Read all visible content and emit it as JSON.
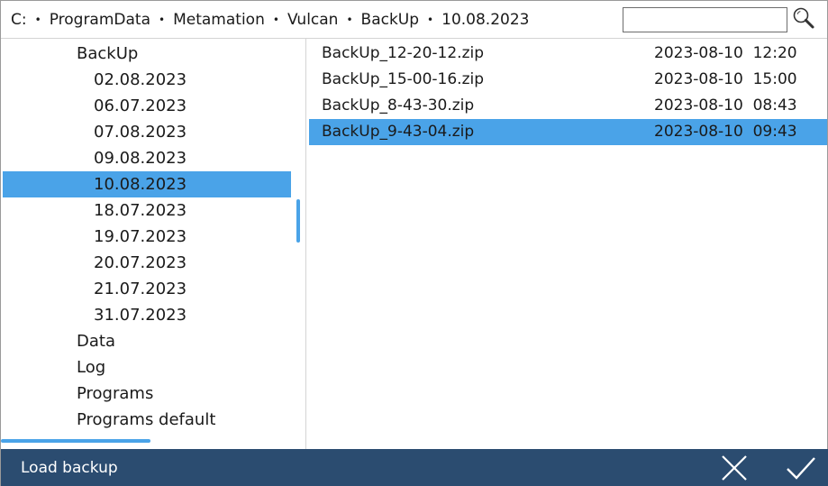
{
  "breadcrumb": {
    "items": [
      "C:",
      "ProgramData",
      "Metamation",
      "Vulcan",
      "BackUp",
      "10.08.2023"
    ],
    "separator": "•"
  },
  "search": {
    "value": "",
    "placeholder": ""
  },
  "tree": {
    "items": [
      {
        "label": "BackUp",
        "level": 1,
        "selected": false
      },
      {
        "label": "02.08.2023",
        "level": 2,
        "selected": false
      },
      {
        "label": "06.07.2023",
        "level": 2,
        "selected": false
      },
      {
        "label": "07.08.2023",
        "level": 2,
        "selected": false
      },
      {
        "label": "09.08.2023",
        "level": 2,
        "selected": false
      },
      {
        "label": "10.08.2023",
        "level": 2,
        "selected": true
      },
      {
        "label": "18.07.2023",
        "level": 2,
        "selected": false
      },
      {
        "label": "19.07.2023",
        "level": 2,
        "selected": false
      },
      {
        "label": "20.07.2023",
        "level": 2,
        "selected": false
      },
      {
        "label": "21.07.2023",
        "level": 2,
        "selected": false
      },
      {
        "label": "31.07.2023",
        "level": 2,
        "selected": false
      },
      {
        "label": "Data",
        "level": 1,
        "selected": false
      },
      {
        "label": "Log",
        "level": 1,
        "selected": false
      },
      {
        "label": "Programs",
        "level": 1,
        "selected": false
      },
      {
        "label": "Programs default",
        "level": 1,
        "selected": false
      }
    ]
  },
  "files": {
    "items": [
      {
        "name": "BackUp_12-20-12.zip",
        "date": "2023-08-10  12:20",
        "selected": false
      },
      {
        "name": "BackUp_15-00-16.zip",
        "date": "2023-08-10  15:00",
        "selected": false
      },
      {
        "name": "BackUp_8-43-30.zip",
        "date": "2023-08-10  08:43",
        "selected": false
      },
      {
        "name": "BackUp_9-43-04.zip",
        "date": "2023-08-10  09:43",
        "selected": true
      }
    ]
  },
  "footer": {
    "title": "Load backup"
  },
  "icons": {
    "search": "search-icon",
    "cancel": "close-icon",
    "confirm": "check-icon"
  },
  "colors": {
    "accent": "#4aa3e8",
    "footer_bg": "#2b4c70",
    "footer_text": "#ffffff"
  }
}
